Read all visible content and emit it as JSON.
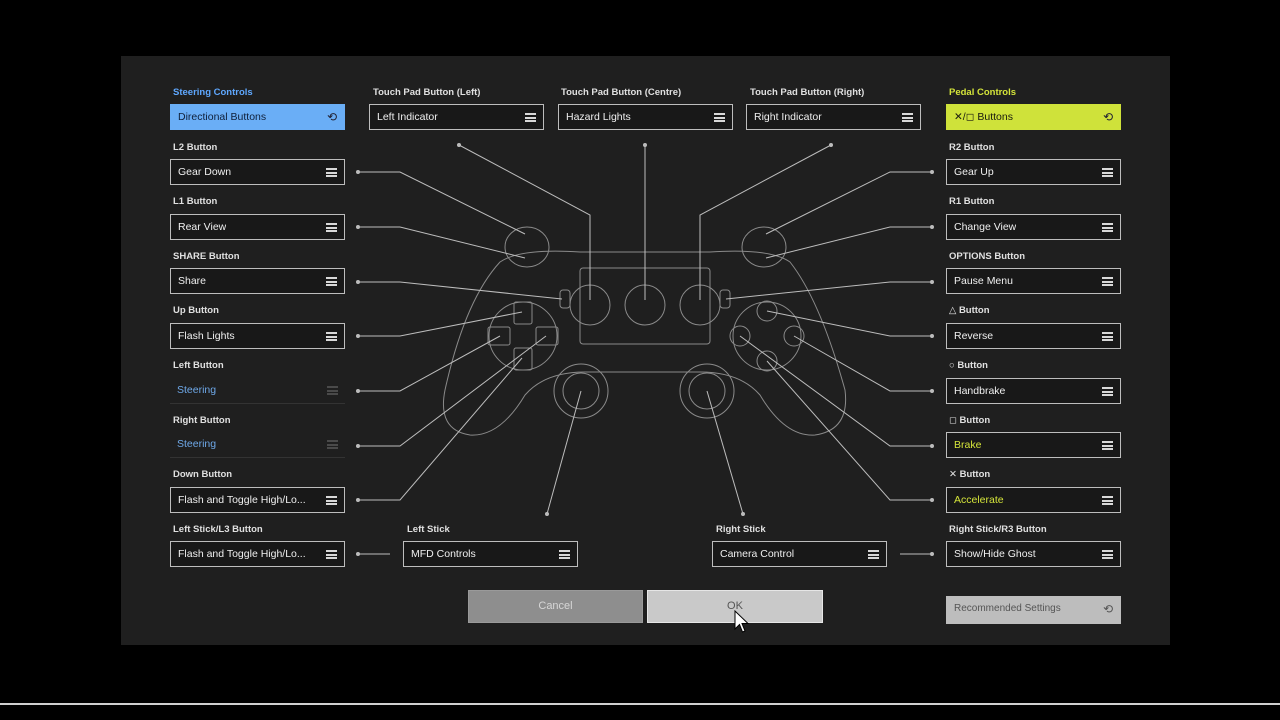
{
  "steering": {
    "label": "Steering Controls",
    "value": "Directional Buttons",
    "icon": "cycle-icon"
  },
  "pedal": {
    "label": "Pedal Controls",
    "value": "✕/◻ Buttons",
    "icon": "cycle-icon"
  },
  "touch": {
    "left": {
      "label": "Touch Pad Button (Left)",
      "value": "Left Indicator"
    },
    "centre": {
      "label": "Touch Pad Button (Centre)",
      "value": "Hazard Lights"
    },
    "right": {
      "label": "Touch Pad Button (Right)",
      "value": "Right Indicator"
    }
  },
  "left_column": [
    {
      "label": "L2 Button",
      "value": "Gear Down"
    },
    {
      "label": "L1 Button",
      "value": "Rear View"
    },
    {
      "label": "SHARE Button",
      "value": "Share"
    },
    {
      "label": "Up Button",
      "value": "Flash Lights"
    },
    {
      "label": "Left Button",
      "value": "Steering"
    },
    {
      "label": "Right Button",
      "value": "Steering"
    },
    {
      "label": "Down Button",
      "value": "Flash and Toggle High/Lo..."
    },
    {
      "label": "Left Stick/L3 Button",
      "value": "Flash and Toggle High/Lo..."
    }
  ],
  "right_column": [
    {
      "label": "R2 Button",
      "value": "Gear Up"
    },
    {
      "label": "R1 Button",
      "value": "Change View"
    },
    {
      "label": "OPTIONS Button",
      "value": "Pause Menu"
    },
    {
      "label": "△ Button",
      "value": "Reverse"
    },
    {
      "label": "○ Button",
      "value": "Handbrake"
    },
    {
      "label": "◻ Button",
      "value": "Brake"
    },
    {
      "label": "✕ Button",
      "value": "Accelerate"
    },
    {
      "label": "Right Stick/R3 Button",
      "value": "Show/Hide Ghost"
    }
  ],
  "sticks": {
    "left": {
      "label": "Left Stick",
      "value": "MFD Controls"
    },
    "right": {
      "label": "Right Stick",
      "value": "Camera Control"
    }
  },
  "buttons": {
    "cancel": "Cancel",
    "ok": "OK",
    "recommended": "Recommended Settings"
  },
  "colors": {
    "panel": "#1f1f1f",
    "steering_accent": "#6aaef6",
    "pedal_accent": "#cfe23a",
    "line": "#bdbdbd"
  }
}
